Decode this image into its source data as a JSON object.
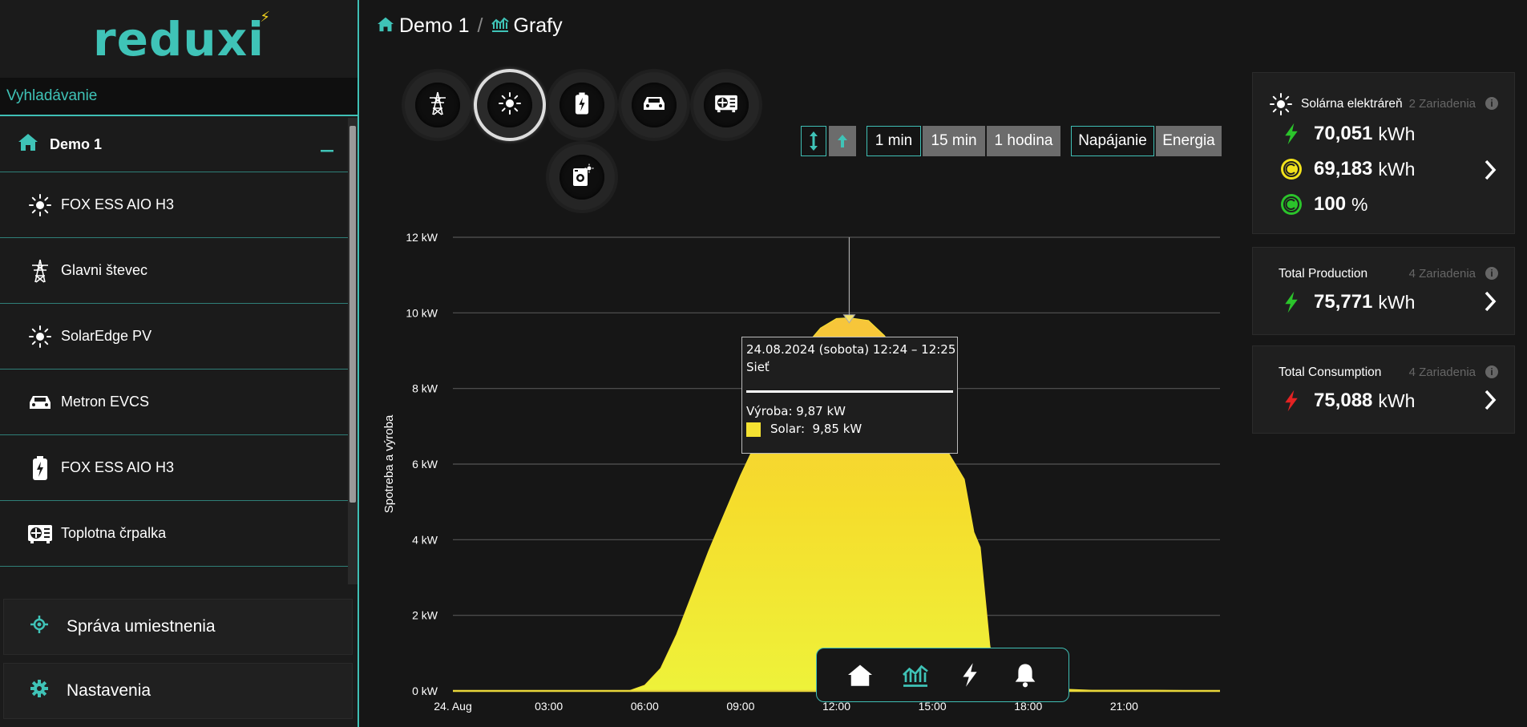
{
  "app": {
    "logo": "reduxi"
  },
  "sidebar": {
    "search_label": "Vyhladávanie",
    "root": {
      "label": "Demo 1"
    },
    "items": [
      {
        "label": "FOX ESS AIO H3",
        "icon": "sun-icon"
      },
      {
        "label": "Glavni števec",
        "icon": "power-tower-icon"
      },
      {
        "label": "SolarEdge PV",
        "icon": "sun-icon"
      },
      {
        "label": "Metron EVCS",
        "icon": "car-icon"
      },
      {
        "label": "FOX ESS AIO H3",
        "icon": "battery-icon"
      },
      {
        "label": "Toplotna črpalka",
        "icon": "heat-pump-icon"
      }
    ],
    "bottom": [
      {
        "label": "Správa umiestnenia",
        "icon": "location-icon"
      },
      {
        "label": "Nastavenia",
        "icon": "gear-icon"
      }
    ]
  },
  "breadcrumb": {
    "home": "Demo 1",
    "sep": "/",
    "current": "Grafy"
  },
  "controls": {
    "resolutions": [
      "1 min",
      "15 min",
      "1 hodina"
    ],
    "modes": [
      "Napájanie",
      "Energia"
    ]
  },
  "tooltip": {
    "time": "24.08.2024 (sobota) 12:24 – 12:25",
    "group": "Sieť",
    "production": "Výroba: 9,87 kW",
    "solar": "Solar:  9,85 kW"
  },
  "chart_data": {
    "type": "area",
    "ylabel": "Spotreba a výroba",
    "y_ticks": [
      "12 kW",
      "10 kW",
      "8 kW",
      "6 kW",
      "4 kW",
      "2 kW",
      "0 kW"
    ],
    "ylim": [
      0,
      12
    ],
    "x_ticks": [
      "24. Aug",
      "03:00",
      "06:00",
      "09:00",
      "12:00",
      "15:00",
      "18:00",
      "21:00"
    ],
    "xlim_hours": [
      0,
      24
    ],
    "grid": true,
    "series": [
      {
        "name": "Solar",
        "color": "#f5e232",
        "x_hours": [
          0,
          5.5,
          6.0,
          6.5,
          7.0,
          7.5,
          8.0,
          8.5,
          9.0,
          9.5,
          10.0,
          10.5,
          11.0,
          11.5,
          12.0,
          12.4,
          13.0,
          13.5,
          14.0,
          14.5,
          15.0,
          15.5,
          16.0,
          16.3,
          16.5,
          16.8,
          17.0,
          17.5,
          18.0,
          19.0,
          20.0,
          21.0,
          22.0,
          24.0
        ],
        "values": [
          0,
          0,
          0.15,
          0.6,
          1.5,
          2.6,
          3.7,
          4.7,
          5.7,
          6.6,
          7.5,
          8.4,
          9.1,
          9.6,
          9.85,
          9.87,
          9.8,
          9.4,
          8.8,
          8.0,
          7.0,
          6.3,
          5.6,
          4.2,
          3.8,
          1.2,
          0.3,
          0.25,
          0.15,
          0.05,
          0.02,
          0.02,
          0.02,
          0
        ]
      }
    ],
    "cursor_hour": 12.4
  },
  "cards": [
    {
      "title": "Solárna elektráreň",
      "count": "2 Zariadenia",
      "rows": [
        {
          "icon": "bolt-green-icon",
          "value": "70,051",
          "unit": "kWh"
        },
        {
          "icon": "self-consumption-icon",
          "value": "69,183",
          "unit": "kWh"
        },
        {
          "icon": "autarky-icon",
          "value": "100",
          "unit": "%"
        }
      ]
    },
    {
      "title": "Total Production",
      "count": "4 Zariadenia",
      "rows": [
        {
          "icon": "bolt-green-icon",
          "value": "75,771",
          "unit": "kWh"
        }
      ]
    },
    {
      "title": "Total Consumption",
      "count": "4 Zariadenia",
      "rows": [
        {
          "icon": "bolt-red-icon",
          "value": "75,088",
          "unit": "kWh"
        }
      ]
    }
  ]
}
